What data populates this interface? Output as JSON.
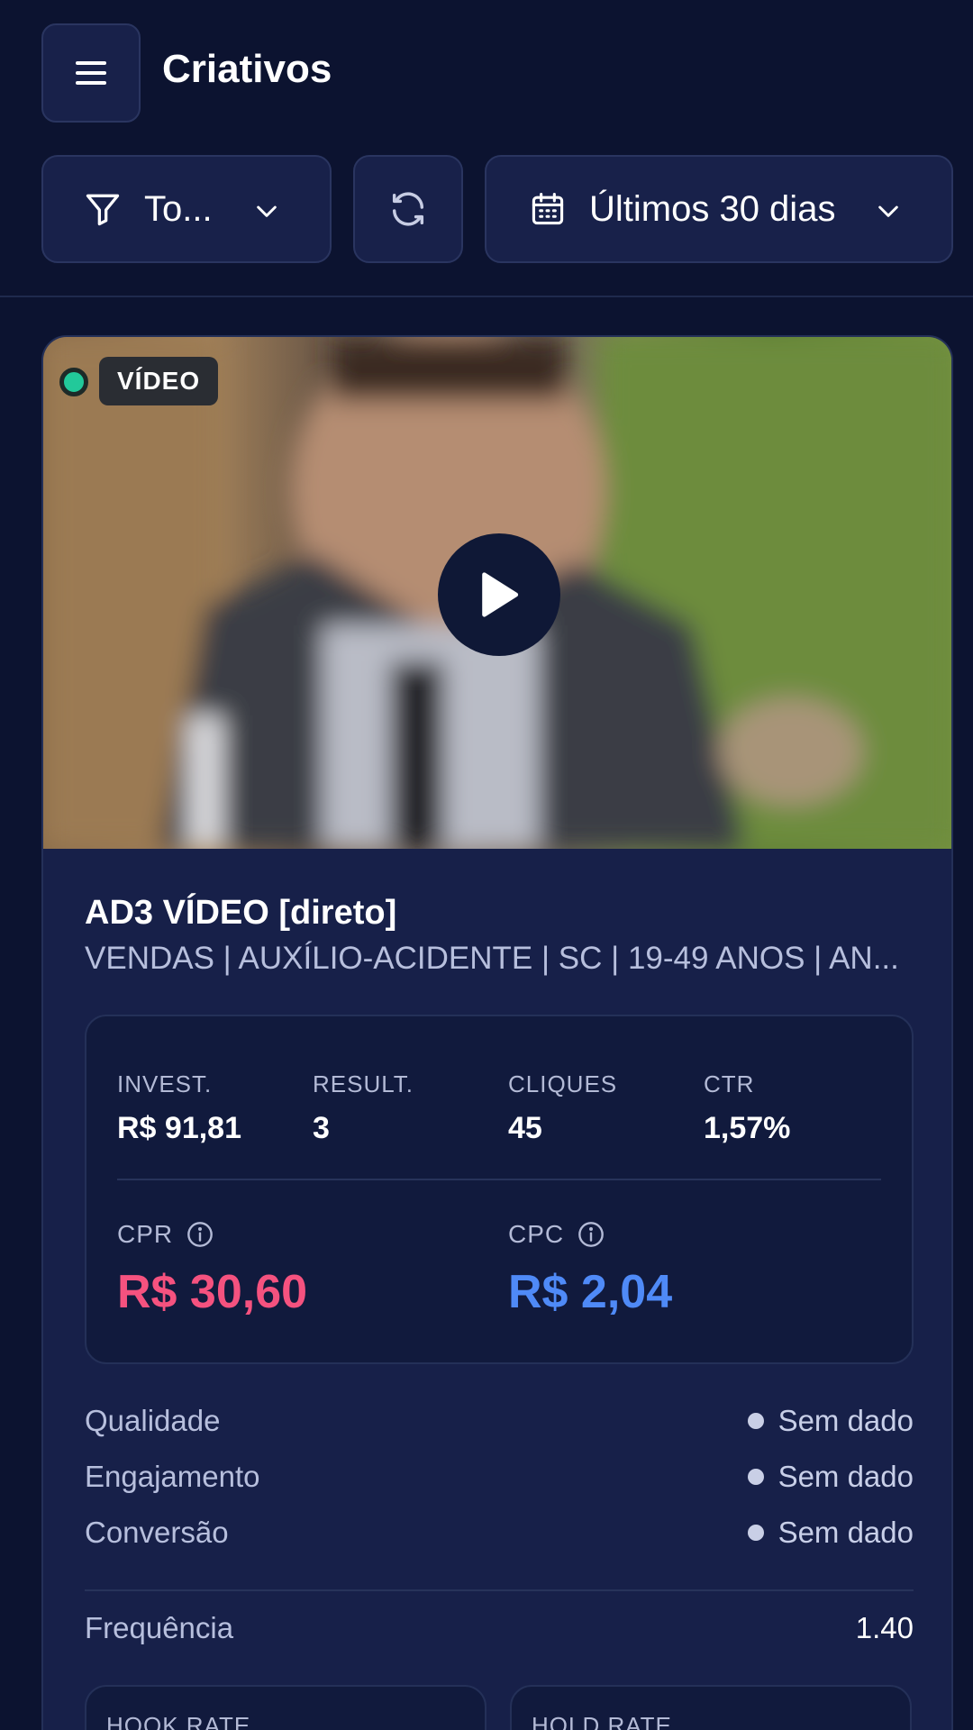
{
  "header": {
    "title": "Criativos"
  },
  "filters": {
    "status_label": "To...",
    "date_range_label": "Últimos 30 dias"
  },
  "creative": {
    "type_badge": "VÍDEO",
    "status_color": "#22c99a",
    "name": "AD3 VÍDEO [direto]",
    "campaign": "VENDAS | AUXÍLIO-ACIDENTE | SC | 19-49 ANOS | AN...",
    "metrics": {
      "invest_label": "INVEST.",
      "invest_value": "R$ 91,81",
      "result_label": "RESULT.",
      "result_value": "3",
      "clicks_label": "CLIQUES",
      "clicks_value": "45",
      "ctr_label": "CTR",
      "ctr_value": "1,57%",
      "cpr_label": "CPR",
      "cpr_value": "R$ 30,60",
      "cpr_color": "#f5527f",
      "cpc_label": "CPC",
      "cpc_value": "R$ 2,04",
      "cpc_color": "#4f8af7"
    },
    "quality": [
      {
        "label": "Qualidade",
        "status": "Sem dado"
      },
      {
        "label": "Engajamento",
        "status": "Sem dado"
      },
      {
        "label": "Conversão",
        "status": "Sem dado"
      }
    ],
    "frequency_label": "Frequência",
    "frequency_value": "1.40",
    "hook_rate_label": "HOOK RATE",
    "hold_rate_label": "HOLD RATE"
  },
  "icons": {
    "menu": "hamburger-icon",
    "filter": "funnel-icon",
    "refresh": "refresh-icon",
    "calendar": "calendar-icon",
    "play": "play-icon",
    "info": "info-icon"
  }
}
